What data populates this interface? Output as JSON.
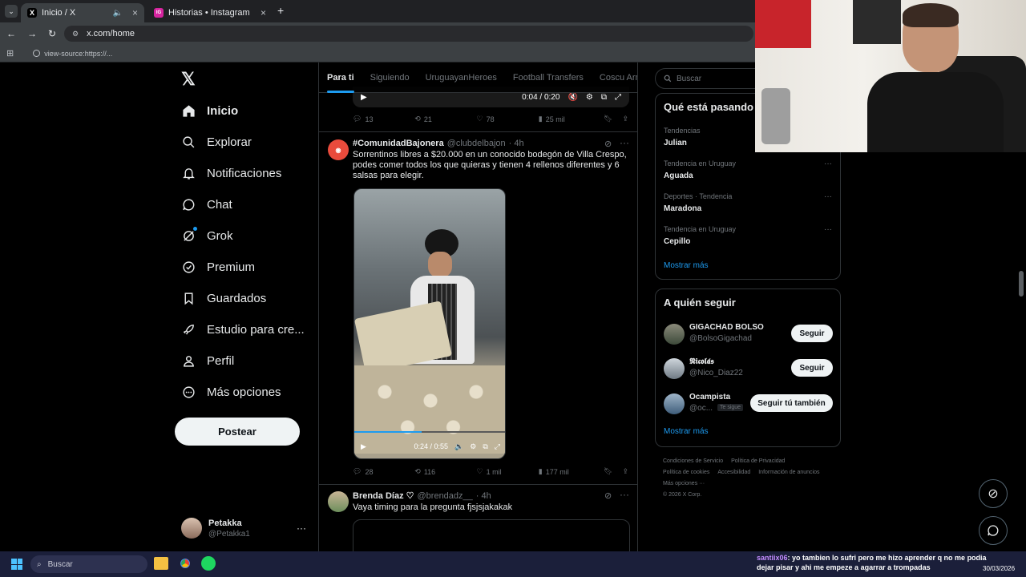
{
  "browser": {
    "tabs": [
      {
        "title": "Inicio / X",
        "favicon": "X"
      },
      {
        "title": "Historias • Instagram",
        "favicon": "IG"
      }
    ],
    "url": "x.com/home",
    "bookmark": "view-source:https://..."
  },
  "nav": {
    "items": [
      {
        "label": "Inicio",
        "icon": "home-icon"
      },
      {
        "label": "Explorar",
        "icon": "search-icon"
      },
      {
        "label": "Notificaciones",
        "icon": "bell-icon"
      },
      {
        "label": "Chat",
        "icon": "chat-icon"
      },
      {
        "label": "Grok",
        "icon": "grok-icon"
      },
      {
        "label": "Premium",
        "icon": "premium-icon"
      },
      {
        "label": "Guardados",
        "icon": "bookmark-icon"
      },
      {
        "label": "Estudio para cre...",
        "icon": "rocket-icon"
      },
      {
        "label": "Perfil",
        "icon": "person-icon"
      },
      {
        "label": "Más opciones",
        "icon": "more-circle-icon"
      }
    ],
    "post_label": "Postear",
    "profile": {
      "name": "Petakka",
      "handle": "@Petakka1"
    }
  },
  "feed": {
    "tabs": [
      "Para ti",
      "Siguiendo",
      "UruguayanHeroes",
      "Football Transfers",
      "Coscu Army"
    ],
    "prev_video_time": "0:04 / 0:20",
    "prev_stats": {
      "replies": "13",
      "reposts": "21",
      "likes": "78",
      "views": "25 mil"
    },
    "tweet1": {
      "name": "#ComunidadBajonera",
      "handle": "@clubdelbajon",
      "time": "· 4h",
      "text": "Sorrentinos libres a $20.000 en un conocido bodegón de Villa Crespo, podes comer todos los que quieras y tienen 4 rellenos diferentes y 6 salsas para elegir.",
      "video_time": "0:24 / 0:55",
      "stats": {
        "replies": "28",
        "reposts": "116",
        "likes": "1 mil",
        "views": "177 mil"
      }
    },
    "tweet2": {
      "name": "Brenda Díaz ♡",
      "handle": "@brendadz__",
      "time": "· 4h",
      "text": "Vaya timing para la pregunta fjsjsjakakak"
    }
  },
  "sidebar": {
    "search_placeholder": "Buscar",
    "trends_title": "Qué está pasando",
    "trends": [
      {
        "category": "Tendencias",
        "name": "Julian"
      },
      {
        "category": "Tendencia en Uruguay",
        "name": "Aguada"
      },
      {
        "category": "Deportes · Tendencia",
        "name": "Maradona"
      },
      {
        "category": "Tendencia en Uruguay",
        "name": "Cepillo"
      }
    ],
    "show_more": "Mostrar más",
    "follow_title": "A quién seguir",
    "follow": [
      {
        "name": "GIGACHAD BOLSO",
        "handle": "@BolsoGigachad",
        "button": "Seguir"
      },
      {
        "name": "𝕹𝖎𝖈𝖔𝖑𝖆́𝖘",
        "handle": "@Nico_Diaz22",
        "button": "Seguir"
      },
      {
        "name": "Ocampista",
        "handle": "@oc...",
        "badge": "Te sigue",
        "button": "Seguir tú también"
      }
    ],
    "footer": [
      "Condiciones de Servicio",
      "Política de Privacidad",
      "Política de cookies",
      "Accesibilidad",
      "Información de anuncios",
      "Más opciones ···",
      "© 2026 X Corp."
    ]
  },
  "taskbar": {
    "search": "Buscar",
    "chat_user": "santiix06",
    "chat_message": ": yo tambien lo sufri pero me hizo aprender q no me podia dejar pisar y ahi me empeze a agarrar a trompadas",
    "date": "30/03/2026"
  },
  "colors": {
    "accent": "#1d9bf0",
    "bg": "#000000",
    "border": "#2f3336",
    "muted": "#71767b"
  }
}
